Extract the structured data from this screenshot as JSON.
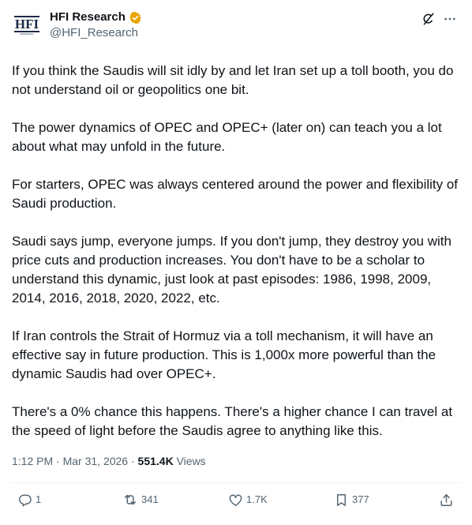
{
  "author": {
    "display_name": "HFI Research",
    "handle": "@HFI_Research",
    "avatar_logo_text": "HFI",
    "avatar_logo_sub": "RESEARCH",
    "verified_color": "#e8a300"
  },
  "tweet": {
    "paragraphs": [
      "If you think the Saudis will sit idly by and let Iran set up a toll booth, you do not understand oil or geopolitics one bit.",
      "The power dynamics of OPEC and OPEC+ (later on) can teach you a lot about what may unfold in the future.",
      "For starters, OPEC was always centered around the power and flexibility of Saudi production.",
      "Saudi says jump, everyone jumps. If you don't jump, they destroy you with price cuts and production increases. You don't have to be a scholar to understand this dynamic, just look at past episodes: 1986, 1998, 2009, 2014, 2016, 2018, 2020, 2022, etc.",
      "If Iran controls the Strait of Hormuz via a toll mechanism, it will have an effective say in future production. This is 1,000x more powerful than the dynamic Saudis had over OPEC+.",
      "There's a 0% chance this happens. There's a higher chance I can travel at the speed of light before the Saudis agree to anything like this."
    ]
  },
  "meta": {
    "time": "1:12 PM",
    "separator": " · ",
    "date": "Mar 31, 2026",
    "views_count": "551.4K",
    "views_label": " Views"
  },
  "actions": {
    "replies": "1",
    "reposts": "341",
    "likes": "1.7K",
    "bookmarks": "377"
  },
  "icons": {
    "top": [
      "grok-icon",
      "more-icon"
    ],
    "actions": [
      "reply-icon",
      "repost-icon",
      "like-icon",
      "bookmark-icon",
      "share-icon"
    ]
  },
  "colors": {
    "text_primary": "#0f1419",
    "text_secondary": "#536471",
    "divider": "#eff3f4"
  }
}
